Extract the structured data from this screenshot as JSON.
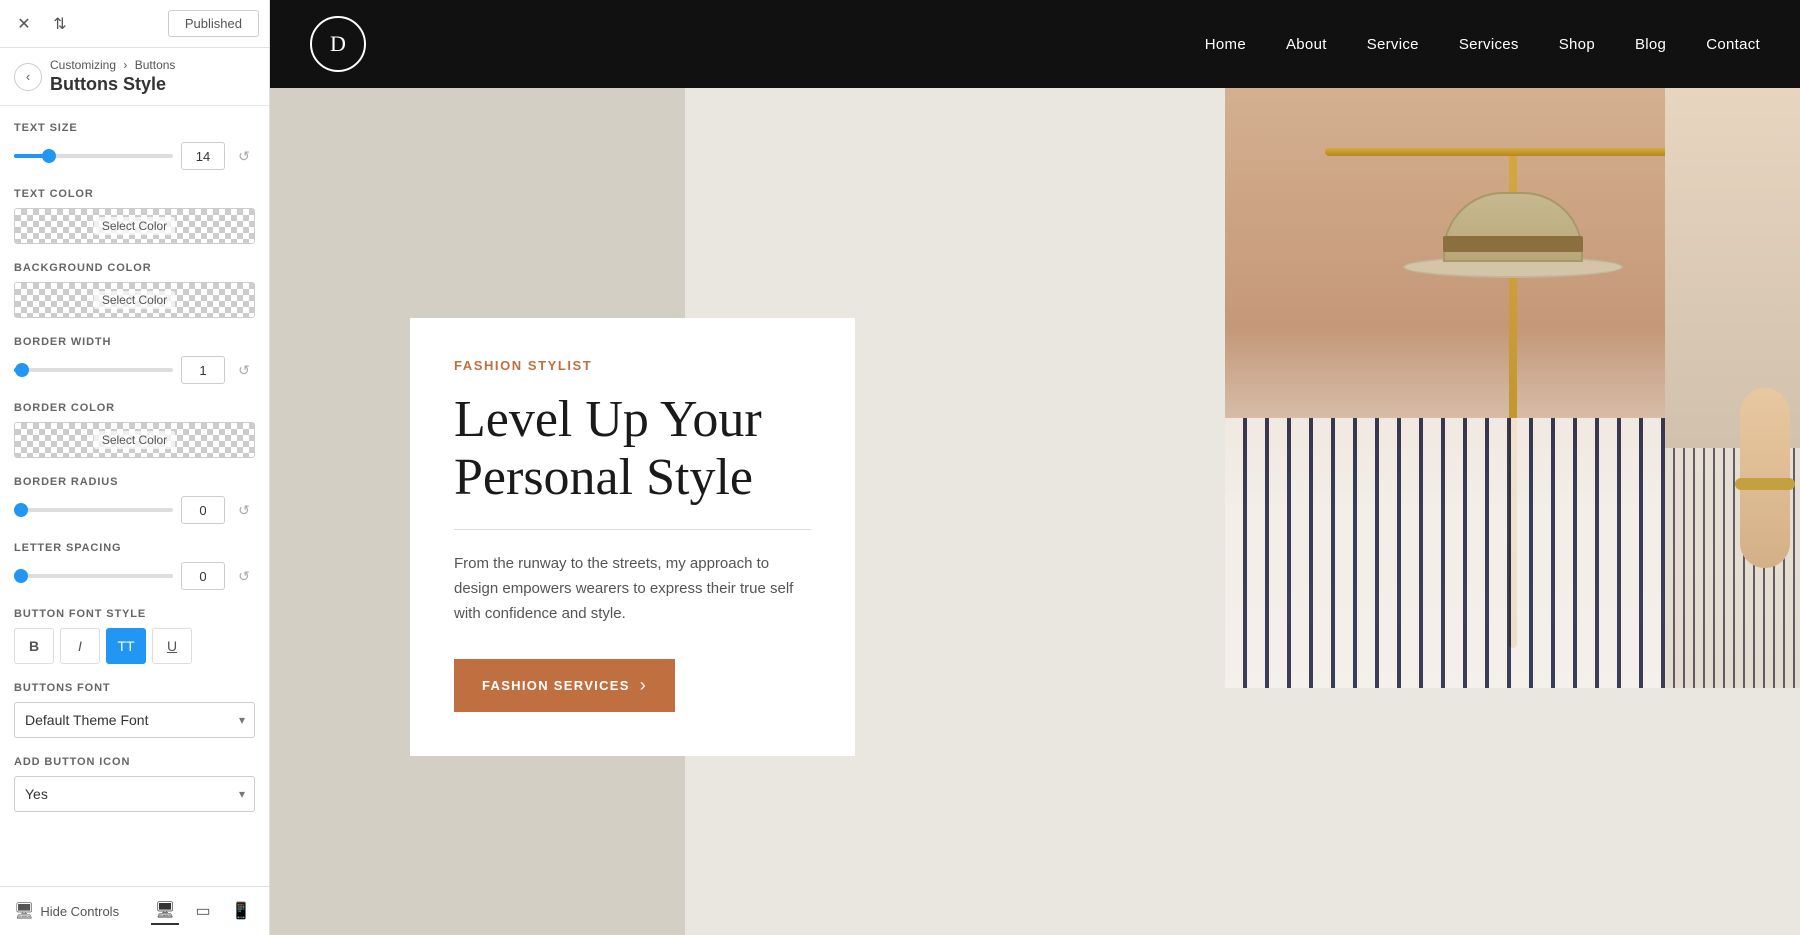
{
  "topBar": {
    "publishedLabel": "Published"
  },
  "breadcrumb": {
    "path": "Customizing",
    "arrow": "›",
    "section": "Buttons"
  },
  "pageTitle": "Buttons Style",
  "controls": {
    "textSize": {
      "label": "TEXT SIZE",
      "value": "14",
      "sliderPercent": 22
    },
    "textColor": {
      "label": "TEXT COLOR",
      "selectLabel": "Select Color"
    },
    "backgroundColor": {
      "label": "BACKGROUND COLOR",
      "selectLabel": "Select Color"
    },
    "borderWidth": {
      "label": "BORDER WIDTH",
      "value": "1",
      "sliderPercent": 5
    },
    "borderColor": {
      "label": "BORDER COLOR",
      "selectLabel": "Select Color"
    },
    "borderRadius": {
      "label": "BORDER RADIUS",
      "value": "0",
      "sliderPercent": 0
    },
    "letterSpacing": {
      "label": "LETTER SPACING",
      "value": "0",
      "sliderPercent": 0
    },
    "buttonFontStyle": {
      "label": "BUTTON FONT STYLE",
      "bold": "B",
      "italic": "I",
      "tt": "TT",
      "underline": "U"
    },
    "buttonsFont": {
      "label": "BUTTONS FONT",
      "value": "Default Theme Font"
    },
    "addButtonIcon": {
      "label": "ADD BUTTON ICON",
      "value": "Yes"
    }
  },
  "bottomBar": {
    "hideControlsLabel": "Hide Controls"
  },
  "preview": {
    "logo": "D",
    "nav": {
      "home": "Home",
      "about": "About",
      "service": "Service",
      "services": "Services",
      "shop": "Shop",
      "blog": "Blog",
      "contact": "Contact"
    },
    "hero": {
      "fashionLabel": "FASHION STYLIST",
      "titleLine1": "Level Up Your",
      "titleLine2": "Personal Style",
      "description": "From the runway to the streets, my approach to design empowers wearers to express their true self with confidence and style.",
      "ctaButton": "FASHION SERVICES",
      "ctaArrow": "›"
    }
  }
}
